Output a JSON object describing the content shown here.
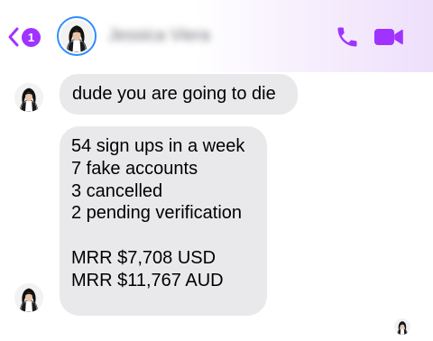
{
  "header": {
    "back_badge_count": "1",
    "contact_name": "Jessica Viera",
    "accent_color": "#a033ff"
  },
  "icons": {
    "back": "chevron-left-icon",
    "call": "phone-icon",
    "video": "video-camera-icon"
  },
  "messages": [
    {
      "sender": "Jessica Viera",
      "text": "dude you are going to die"
    },
    {
      "sender": "Jessica Viera",
      "lines": [
        "54 sign ups in a week",
        "7 fake accounts",
        "3 cancelled",
        "2 pending verification",
        "",
        "MRR $7,708 USD",
        "MRR $11,767 AUD"
      ]
    }
  ],
  "colors": {
    "bubble_background": "#e9e9eb",
    "header_gradient_end": "#eedffb",
    "avatar_ring": "#2f8cff"
  }
}
